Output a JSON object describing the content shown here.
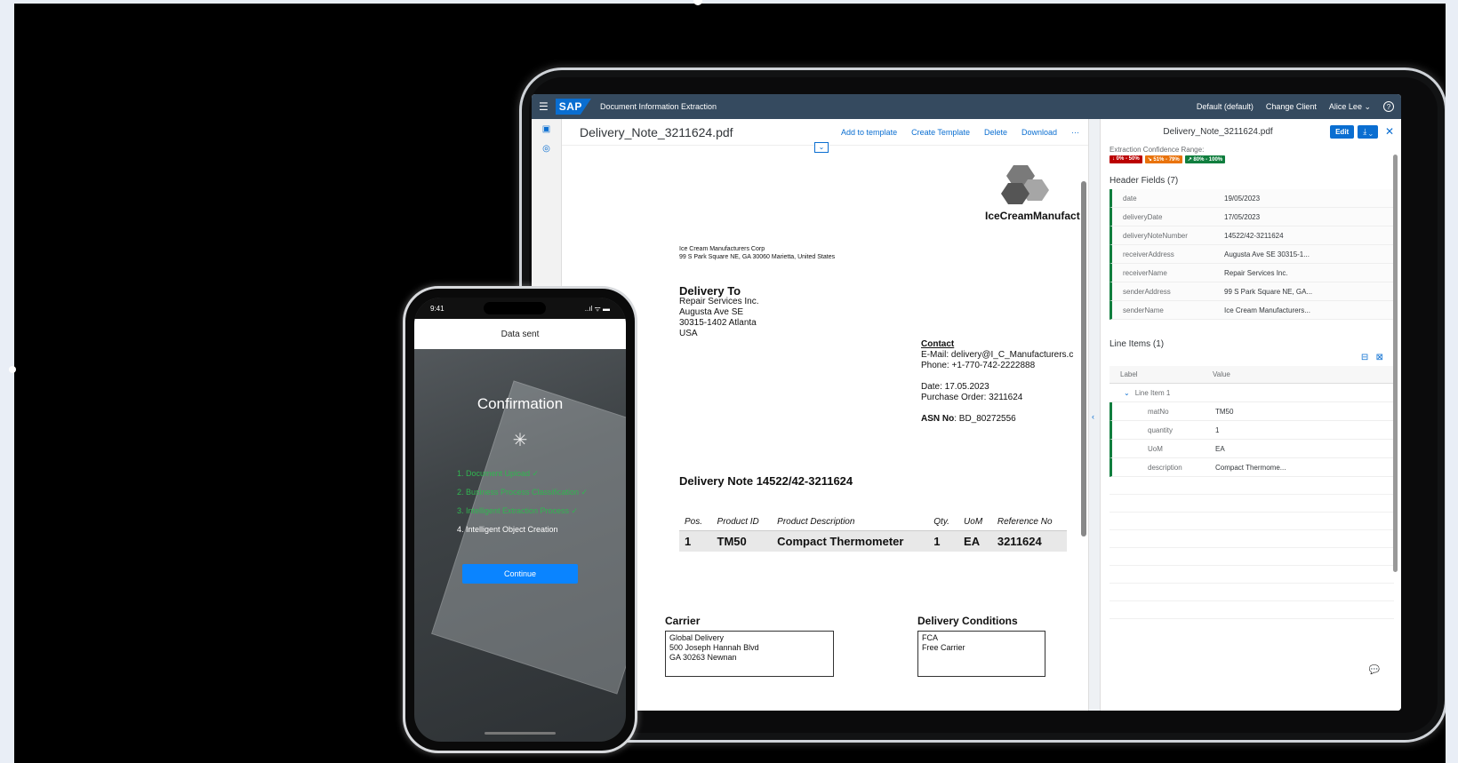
{
  "shell": {
    "app_title": "Document Information Extraction",
    "tenant": "Default (default)",
    "change_client": "Change Client",
    "user": "Alice Lee",
    "help_icon": "help-icon",
    "logo": "SAP"
  },
  "document": {
    "file_name": "Delivery_Note_3211624.pdf",
    "actions": [
      "Add to template",
      "Create Template",
      "Delete",
      "Download",
      "···"
    ],
    "company": "IceCreamManufact",
    "sender_line1": "Ice Cream Manufacturers Corp",
    "sender_line2": "99 S Park Square NE, GA 30060 Marietta, United States",
    "delivery_to": {
      "heading": "Delivery To",
      "lines": [
        "Repair Services Inc.",
        "Augusta Ave SE",
        "30315-1402 Atlanta",
        "USA"
      ]
    },
    "contact": {
      "heading": "Contact",
      "email": "E-Mail: delivery@I_C_Manufacturers.c",
      "phone": "Phone: +1-770-742-2222888"
    },
    "date": "Date: 17.05.2023",
    "purchase_order": "Purchase Order: 3211624",
    "asn_label": "ASN No",
    "asn_value": ": BD_80272556",
    "title": "Delivery Note 14522/42-3211624",
    "table": {
      "headers": [
        "Pos.",
        "Product ID",
        "Product Description",
        "Qty.",
        "UoM",
        "Reference No"
      ],
      "rows": [
        [
          "1",
          "TM50",
          "Compact Thermometer",
          "1",
          "EA",
          "3211624"
        ]
      ]
    },
    "carrier": {
      "heading": "Carrier",
      "lines": [
        "Global Delivery",
        "500 Joseph Hannah Blvd",
        "GA 30263 Newnan"
      ]
    },
    "conditions": {
      "heading": "Delivery Conditions",
      "lines": [
        "FCA",
        "Free Carrier"
      ]
    }
  },
  "details": {
    "title": "Delivery_Note_3211624.pdf",
    "edit_label": "Edit",
    "download_label": "⤓ ⌄",
    "close_label": "✕",
    "confidence_label": "Extraction Confidence Range:",
    "badges": [
      {
        "label": "↓ 0% - 50%",
        "color": "#bb0000"
      },
      {
        "label": "↘ 51% - 79%",
        "color": "#e9730c"
      },
      {
        "label": "↗ 80% - 100%",
        "color": "#107e3e"
      }
    ],
    "header_fields_title": "Header Fields (7)",
    "header_fields": [
      {
        "label": "date",
        "value": "19/05/2023"
      },
      {
        "label": "deliveryDate",
        "value": "17/05/2023"
      },
      {
        "label": "deliveryNoteNumber",
        "value": "14522/42-3211624"
      },
      {
        "label": "receiverAddress",
        "value": "Augusta Ave SE 30315-1..."
      },
      {
        "label": "receiverName",
        "value": "Repair Services Inc."
      },
      {
        "label": "senderAddress",
        "value": "99 S Park Square NE, GA..."
      },
      {
        "label": "senderName",
        "value": "Ice Cream Manufacturers..."
      }
    ],
    "line_items_title": "Line Items (1)",
    "line_items_header": {
      "label": "Label",
      "value": "Value"
    },
    "line_item_group": "Line Item 1",
    "line_items": [
      {
        "label": "matNo",
        "value": "TM50"
      },
      {
        "label": "quantity",
        "value": "1"
      },
      {
        "label": "UoM",
        "value": "EA"
      },
      {
        "label": "description",
        "value": "Compact Thermome..."
      }
    ]
  },
  "phone": {
    "time": "9:41",
    "signal": "..ıl ᯤ ▬",
    "header": "Data sent",
    "title": "Confirmation",
    "spinner": "✳",
    "steps": [
      "1. Document Upload ✓",
      "2. Business Process Classification ✓",
      "3. Intelligent Extraction Process ✓",
      "4. Intelligent Object Creation"
    ],
    "continue_label": "Continue"
  }
}
